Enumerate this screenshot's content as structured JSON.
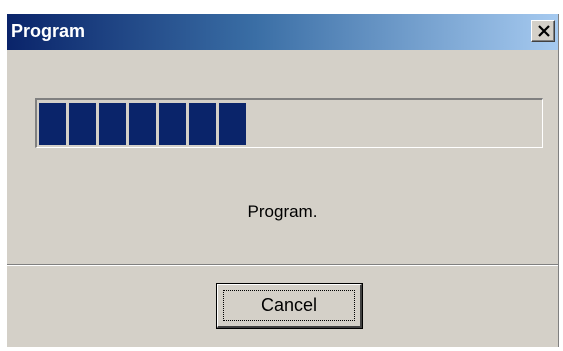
{
  "window": {
    "title": "Program",
    "close_icon": "close-x-icon"
  },
  "progress": {
    "blocks_filled": 7,
    "fill_color": "#0a246a"
  },
  "status_text": "Program.",
  "buttons": {
    "cancel_label": "Cancel"
  },
  "colors": {
    "title_gradient_start": "#0a246a",
    "title_gradient_end": "#a6caf0",
    "dialog_background": "#d4d0c8"
  }
}
